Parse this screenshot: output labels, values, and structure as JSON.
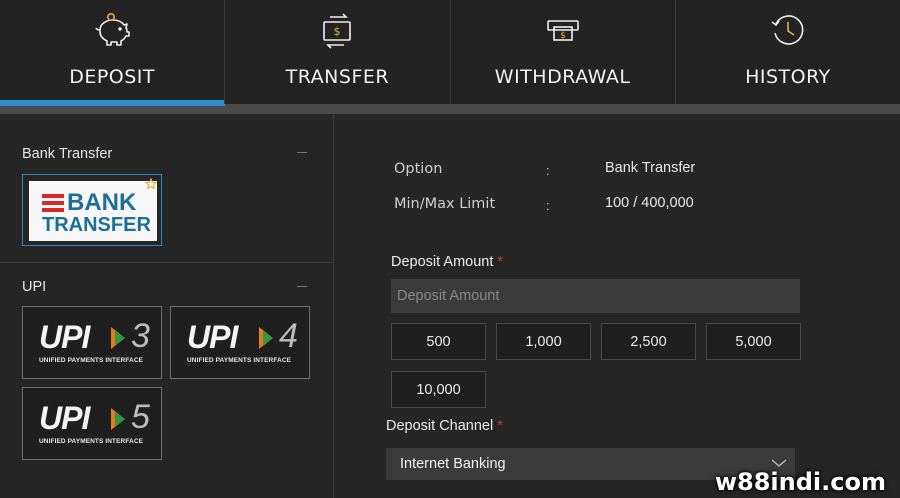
{
  "tabs": [
    {
      "label": "DEPOSIT",
      "icon": "piggy-bank-icon",
      "active": true
    },
    {
      "label": "TRANSFER",
      "icon": "money-transfer-icon",
      "active": false
    },
    {
      "label": "WITHDRAWAL",
      "icon": "cash-withdrawal-icon",
      "active": false
    },
    {
      "label": "HISTORY",
      "icon": "history-clock-icon",
      "active": false
    }
  ],
  "left": {
    "bank_section_title": "Bank Transfer",
    "bank_card": {
      "line1": "BANK",
      "line2": "TRANSFER",
      "starred": true
    },
    "upi_section_title": "UPI",
    "upi_cards": [
      {
        "word": "UPI",
        "number": "3",
        "sub": "UNIFIED PAYMENTS INTERFACE"
      },
      {
        "word": "UPI",
        "number": "4",
        "sub": "UNIFIED PAYMENTS INTERFACE"
      },
      {
        "word": "UPI",
        "number": "5",
        "sub": "UNIFIED PAYMENTS INTERFACE"
      }
    ]
  },
  "info": {
    "option_label": "Option",
    "option_value": "Bank Transfer",
    "limit_label": "Min/Max Limit",
    "limit_value": "100 / 400,000",
    "separator": ":"
  },
  "deposit": {
    "amount_label": "Deposit Amount",
    "required_mark": "*",
    "amount_placeholder": "Deposit Amount",
    "amount_value": "",
    "quick_amounts": [
      "500",
      "1,000",
      "2,500",
      "5,000",
      "10,000"
    ],
    "channel_label": "Deposit Channel",
    "channel_value": "Internet Banking"
  },
  "watermark": "w88indi.com",
  "colors": {
    "accent": "#2d8bd4",
    "required": "#d9342b",
    "icon_gold": "#e2b23a",
    "bank_red": "#d9262a",
    "bank_blue": "#1e6d9a"
  }
}
